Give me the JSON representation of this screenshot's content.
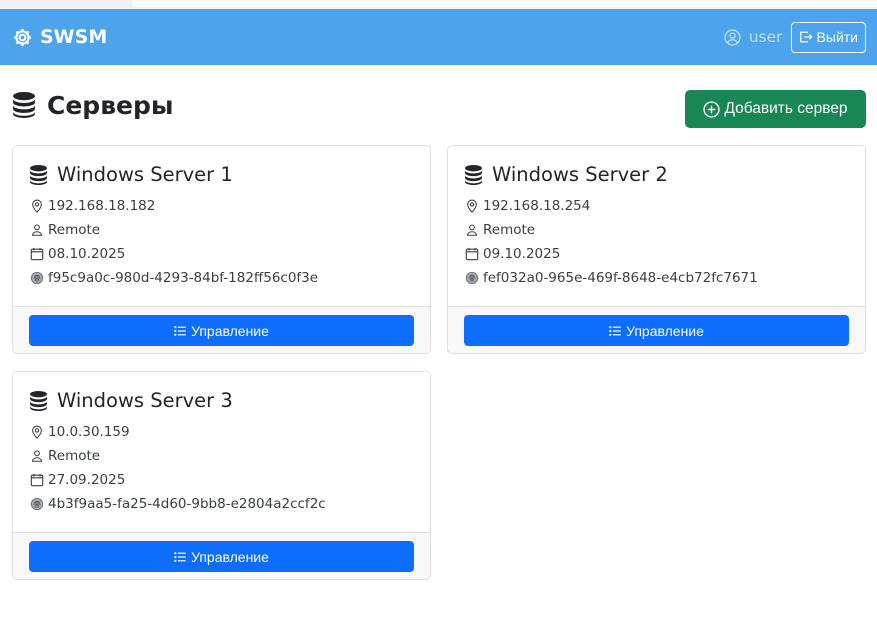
{
  "app": {
    "brand": "SWSM"
  },
  "header": {
    "user_label": "user",
    "logout_label": "Выйти"
  },
  "page": {
    "title": "Серверы",
    "add_button_label": "Добавить сервер"
  },
  "servers": [
    {
      "name": "Windows Server 1",
      "ip": "192.168.18.182",
      "user": "Remote",
      "date": "08.10.2025",
      "id": "f95c9a0c-980d-4293-84bf-182ff56c0f3e",
      "manage_label": "Управление"
    },
    {
      "name": "Windows Server 2",
      "ip": "192.168.18.254",
      "user": "Remote",
      "date": "09.10.2025",
      "id": "fef032a0-965e-469f-8648-e4cb72fc7671",
      "manage_label": "Управление"
    },
    {
      "name": "Windows Server 3",
      "ip": "10.0.30.159",
      "user": "Remote",
      "date": "27.09.2025",
      "id": "4b3f9aa5-fa25-4d60-9bb8-e2804a2ccf2c",
      "manage_label": "Управление"
    }
  ],
  "colors": {
    "navbar": "#4da3ec",
    "add_button": "#198754",
    "manage_button": "#0d6efd"
  },
  "icons": {
    "brand": "gear-icon",
    "user": "person-circle-icon",
    "logout": "box-arrow-right-icon",
    "title": "database-icon",
    "add": "plus-circle-icon",
    "ip": "geo-alt-icon",
    "account": "person-icon",
    "date": "calendar-icon",
    "id": "fingerprint-icon",
    "manage": "list-ul-icon"
  }
}
